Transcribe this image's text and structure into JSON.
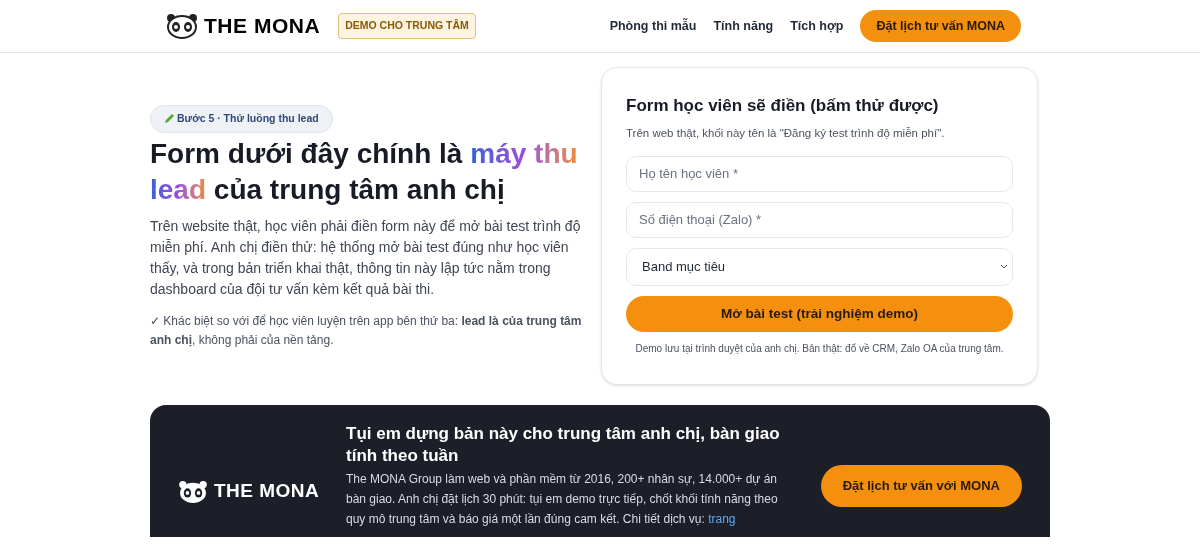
{
  "header": {
    "logo_text": "THE MONA",
    "badge": "DEMO CHO TRUNG TÂM",
    "nav": [
      "Phòng thi mẫu",
      "Tính năng",
      "Tích hợp"
    ],
    "cta": "Đặt lịch tư vấn MONA"
  },
  "intro": {
    "step_badge": "Bước 5 · Thử luồng thu lead",
    "heading_before": "Form dưới đây chính là ",
    "heading_highlight": "máy thu lead",
    "heading_after": " của trung tâm anh chị",
    "paragraph": "Trên website thật, học viên phải điền form này để mở bài test trình độ miễn phí. Anh chị điền thử: hệ thống mở bài test đúng như học viên thấy, và trong bản triển khai thật, thông tin này lập tức nằm trong dashboard của đội tư vấn kèm kết quả bài thi.",
    "note": "✓ Khác biệt so với để học viên luyện trên app bên thứ ba: **lead là của trung tâm anh chị**, không phải của nền tảng."
  },
  "form": {
    "title": "Form học viên sẽ điền (bấm thử được)",
    "subtitle": "Trên web thật, khối này tên là \"Đăng ký test trình độ miễn phí\".",
    "fields": [
      {
        "kind": "text",
        "placeholder": "Họ tên học viên *"
      },
      {
        "kind": "text",
        "placeholder": "Số điện thoại (Zalo) *"
      },
      {
        "kind": "select",
        "value": "Band mục tiêu"
      }
    ],
    "submit": "Mở bài test (trải nghiệm demo)",
    "footnote": "Demo lưu tại trình duyệt của anh chị. Bản thật: đổ về CRM, Zalo OA của trung tâm."
  },
  "banner": {
    "logo_text": "THE MONA",
    "title": "Tụi em dựng bản này cho trung tâm anh chị, bàn giao tính theo tuần",
    "paragraph": "The MONA Group làm web và phần mềm từ 2016, 200+ nhân sự, 14.000+ dự án bàn giao. Anh chị đặt lịch 30 phút: tụi em demo trực tiếp, chốt khối tính năng theo quy mô trung tâm và báo giá một lần đúng cam kết. Chi tiết dịch vụ: ",
    "link": "trang",
    "cta": "Đặt lịch tư vấn với MONA"
  }
}
